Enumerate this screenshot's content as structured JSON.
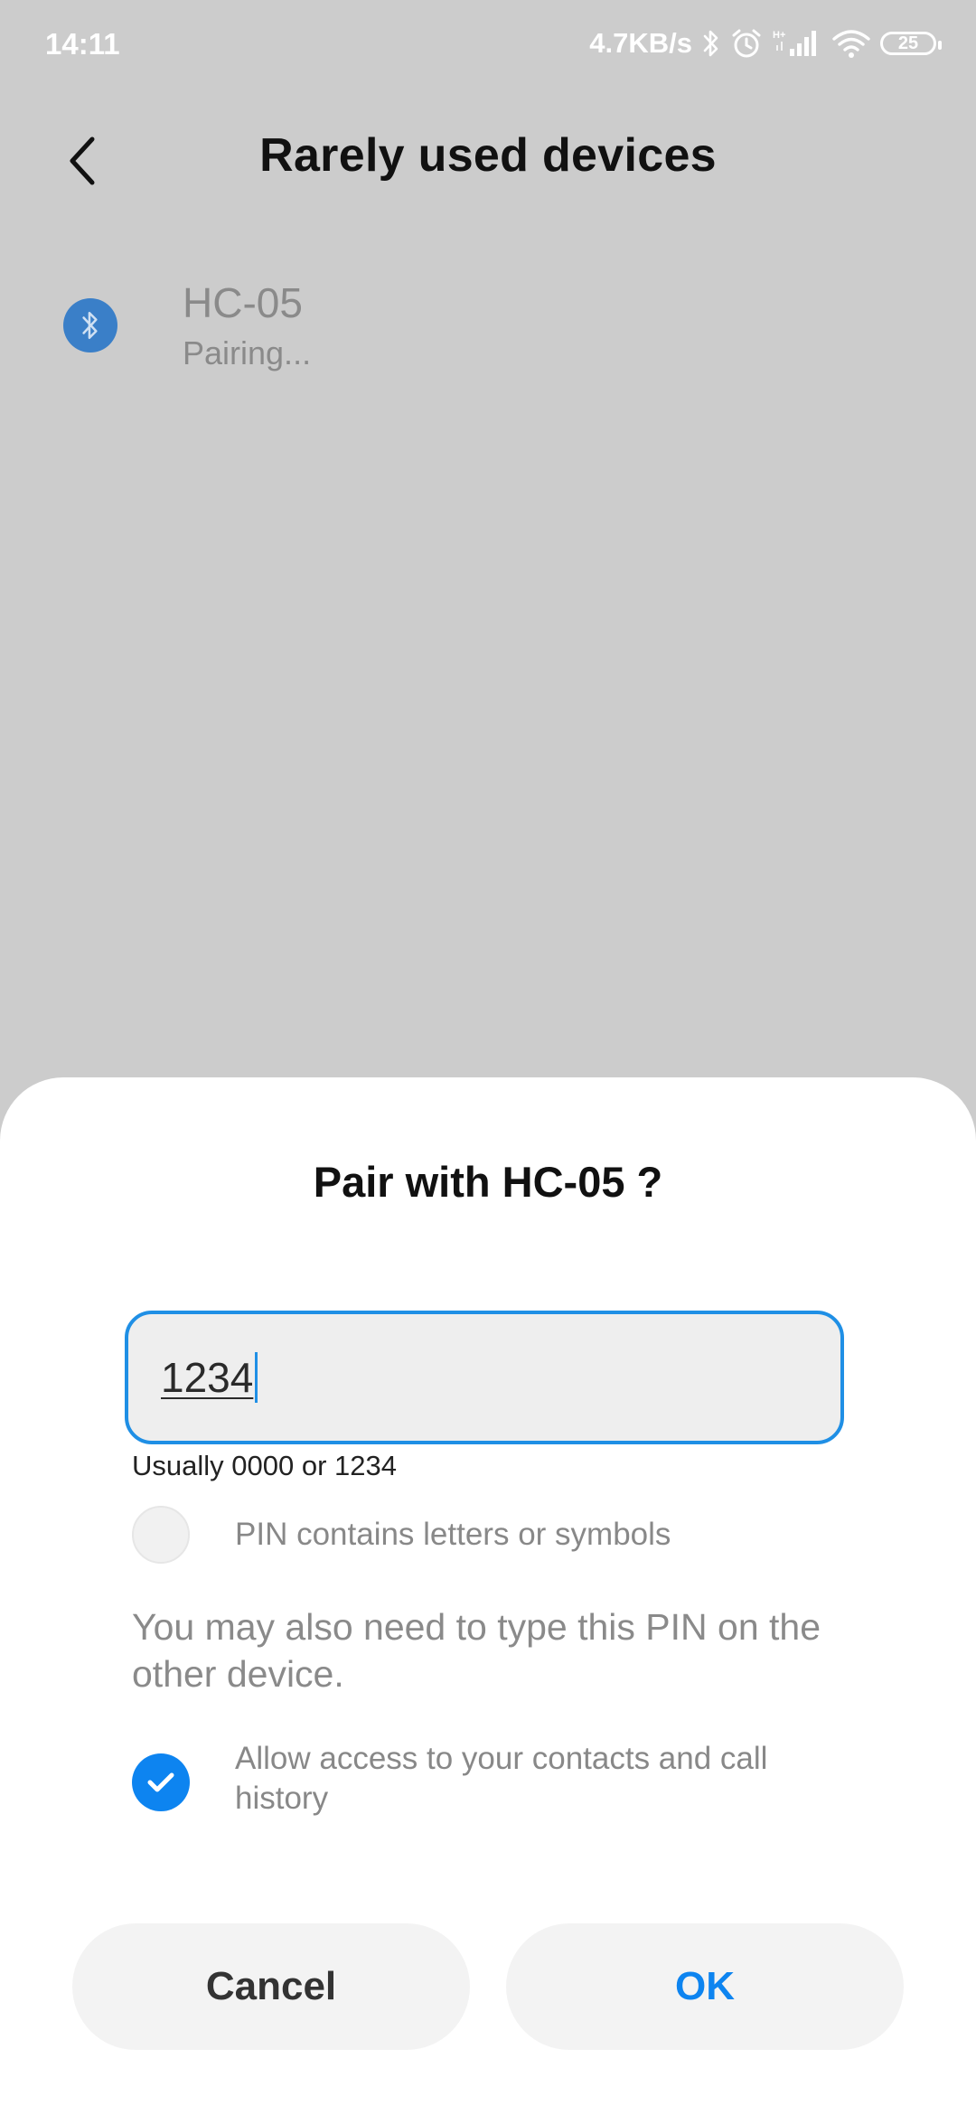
{
  "status_bar": {
    "time": "14:11",
    "net_speed": "4.7KB/s",
    "network_type": "H+",
    "battery": "25",
    "icons": [
      "bluetooth-icon",
      "alarm-icon",
      "cellular-signal-icon",
      "wifi-icon",
      "battery-icon"
    ]
  },
  "header": {
    "title": "Rarely used devices",
    "back_icon": "chevron-left-icon"
  },
  "device": {
    "name": "HC-05",
    "status": "Pairing...",
    "icon": "bluetooth-icon",
    "icon_color": "#3a7fc8"
  },
  "dialog": {
    "title": "Pair with HC-05 ?",
    "pin_value": "1234",
    "pin_hint": "Usually 0000 or 1234",
    "letters_checkbox": {
      "label": "PIN contains letters or symbols",
      "checked": false
    },
    "info_text": "You may also need to type this PIN on the other device.",
    "access_checkbox": {
      "label": "Allow access to your contacts and call history",
      "checked": true
    },
    "cancel_label": "Cancel",
    "ok_label": "OK",
    "accent_color": "#0d84f0"
  }
}
